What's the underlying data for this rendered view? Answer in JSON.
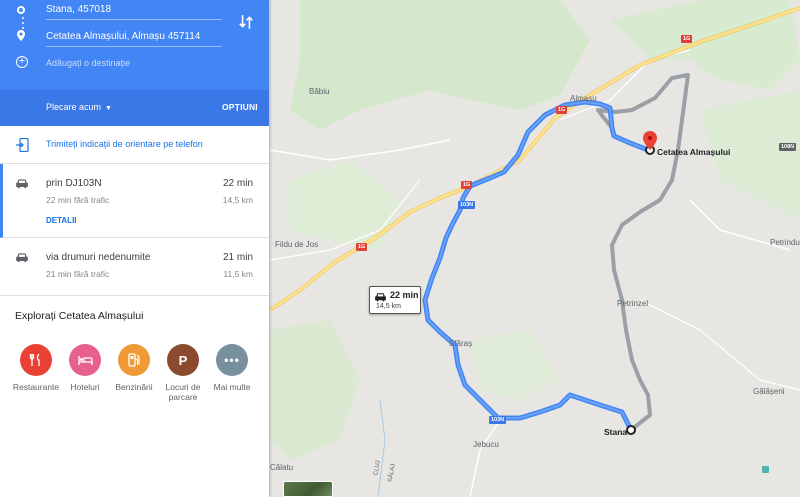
{
  "directions": {
    "origin": "Stana, 457018",
    "destination": "Cetatea Almașului, Almașu 457114",
    "add_destination": "Adăugați o destinație",
    "depart_label": "Plecare acum",
    "options_label": "OPȚIUNI",
    "send_to_phone": "Trimiteți indicații de orientare pe telefon"
  },
  "routes": [
    {
      "name": "prin DJ103N",
      "time": "22 min",
      "traffic": "22 min fără trafic",
      "distance": "14,5 km",
      "details": "DETALII",
      "selected": true
    },
    {
      "name": "via drumuri nedenumite",
      "time": "21 min",
      "traffic": "21 min fără trafic",
      "distance": "11,5 km",
      "selected": false
    }
  ],
  "explore": {
    "title": "Explorați Cetatea Almașului",
    "categories": [
      {
        "label": "Restaurante",
        "icon": "restaurant-icon",
        "color": "#e94235"
      },
      {
        "label": "Hoteluri",
        "icon": "hotel-icon",
        "color": "#e8618c"
      },
      {
        "label": "Benzinării",
        "icon": "gas-station-icon",
        "color": "#f09a36"
      },
      {
        "label": "Locuri de parcare",
        "icon": "parking-icon",
        "color": "#8a4b2e"
      },
      {
        "label": "Mai multe",
        "icon": "more-icon",
        "color": "#78909c"
      }
    ]
  },
  "map": {
    "labels": {
      "babiu": "Băbiu",
      "almasu": "Almașu",
      "cetatea": "Cetatea Almașului",
      "fildu": "Fildu de Jos",
      "petrinzel": "Petrinzel",
      "petrindu": "Petrindu",
      "sfaras": "Sfăraș",
      "stana": "Stana",
      "jebucu": "Jebucu",
      "galaseni": "Gălășeni",
      "calatu": "Călatu",
      "cluj": "CLUJ",
      "salaj": "SĂLAJ"
    },
    "shields": {
      "r1g_a": "1G",
      "r1g_b": "1G",
      "r1g_c": "1G",
      "r1g_d": "1G",
      "r103n_a": "103N",
      "r103n_b": "103N",
      "r108n": "108N"
    },
    "route_info": {
      "time": "22 min",
      "distance": "14,5 km"
    },
    "colors": {
      "route": "#4285f4",
      "alt_route": "#9aa0a6",
      "highway": "#f8d26a",
      "origin": "#1a73e8",
      "destination_pin": "#ea4335"
    }
  }
}
